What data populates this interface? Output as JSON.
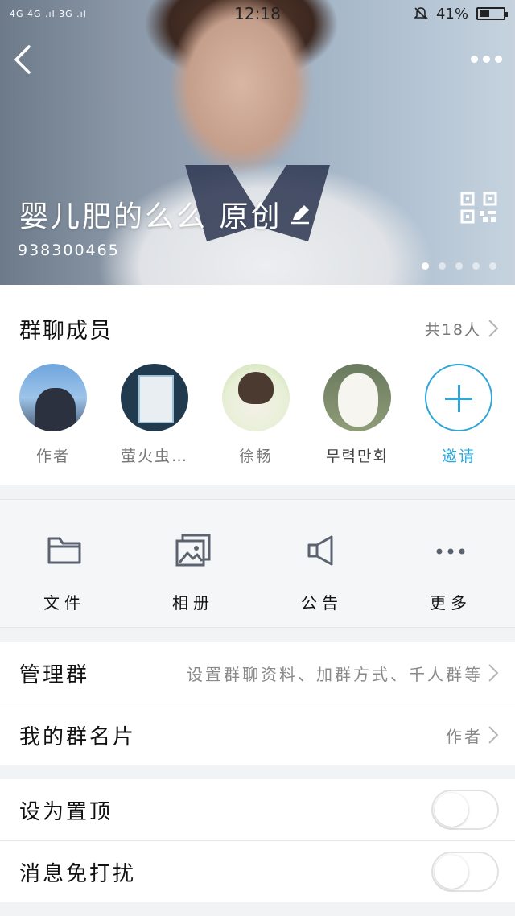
{
  "status_bar": {
    "network": "4G 4G .ıl 3G .ıl",
    "time": "12:18",
    "battery": "41%"
  },
  "header": {
    "group_name": "婴儿肥的么么  原创",
    "group_id": "938300465",
    "carousel": {
      "count": 5,
      "active": 0
    }
  },
  "members": {
    "title": "群聊成员",
    "count": "共18人",
    "list": [
      {
        "name": "作者"
      },
      {
        "name": "萤火虫…"
      },
      {
        "name": "徐畅"
      },
      {
        "name": "무력만회"
      }
    ],
    "invite_label": "邀请"
  },
  "functions": [
    {
      "label": "文件",
      "icon": "folder-icon"
    },
    {
      "label": "相册",
      "icon": "album-icon"
    },
    {
      "label": "公告",
      "icon": "megaphone-icon"
    },
    {
      "label": "更多",
      "icon": "more-dots-icon"
    }
  ],
  "settings": {
    "manage": {
      "label": "管理群",
      "value": "设置群聊资料、加群方式、千人群等"
    },
    "card": {
      "label": "我的群名片",
      "value": "作者"
    },
    "pin": {
      "label": "设为置顶",
      "enabled": false
    },
    "mute": {
      "label": "消息免打扰",
      "enabled": false
    }
  },
  "colors": {
    "accent": "#2fa6d9",
    "background": "#f2f3f5"
  }
}
